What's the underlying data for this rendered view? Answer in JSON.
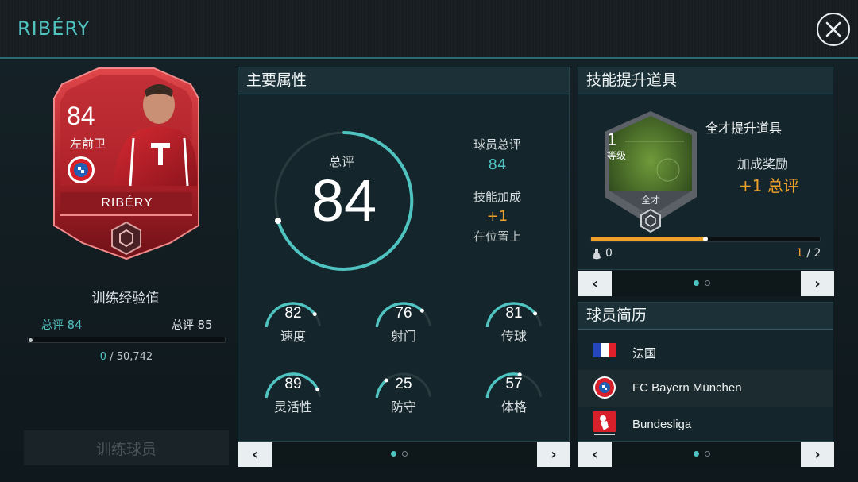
{
  "header": {
    "title": "RIBÉRY"
  },
  "player_card": {
    "rating": "84",
    "position": "左前卫",
    "name": "RIBÉRY"
  },
  "training": {
    "title": "训练经验值",
    "current_label": "总评",
    "current_value": "84",
    "next_label": "总评",
    "next_value": "85",
    "xp_current": "0",
    "xp_separator": "/",
    "xp_total": "50,742",
    "progress_fraction": 0,
    "button_label": "训练球员"
  },
  "main_attributes": {
    "title": "主要属性",
    "overall_label": "总评",
    "overall_value": "84",
    "player_overall_label": "球员总评",
    "player_overall_value": "84",
    "skill_boost_label": "技能加成",
    "skill_boost_value": "+1",
    "skill_boost_note": "在位置上",
    "stats": [
      {
        "value": "82",
        "label": "速度"
      },
      {
        "value": "76",
        "label": "射门"
      },
      {
        "value": "81",
        "label": "传球"
      },
      {
        "value": "89",
        "label": "灵活性"
      },
      {
        "value": "25",
        "label": "防守"
      },
      {
        "value": "57",
        "label": "体格"
      }
    ]
  },
  "skill_boost_item": {
    "title": "技能提升道具",
    "item_name": "全才提升道具",
    "level_number": "1",
    "level_label": "等级",
    "item_tag": "全才",
    "bonus_label": "加成奖励",
    "bonus_value": "+1 总评",
    "owned_count": "0",
    "progress_current": "1",
    "progress_separator": " / ",
    "progress_total": "2",
    "progress_fraction": 0.5
  },
  "player_bio": {
    "title": "球员简历",
    "rows": [
      {
        "text": "法国",
        "icon": "france-flag-icon"
      },
      {
        "text": "FC Bayern München",
        "icon": "bayern-crest-icon"
      },
      {
        "text": "Bundesliga",
        "icon": "bundesliga-logo-icon"
      }
    ]
  },
  "colors": {
    "accent": "#4fc3c0",
    "highlight": "#f0a12a",
    "card_red": "#c0272d"
  }
}
